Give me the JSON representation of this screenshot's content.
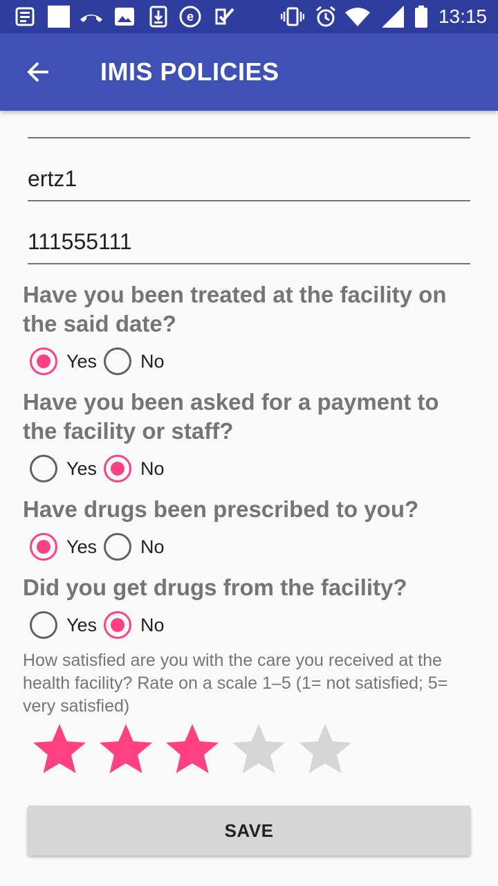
{
  "status_bar": {
    "time": "13:15",
    "icons": [
      "news-icon",
      "square-icon",
      "missed-call-icon",
      "image-icon",
      "download-icon",
      "e-icon",
      "check-icon",
      "vibrate-icon",
      "alarm-icon",
      "wifi-icon",
      "signal-icon",
      "battery-icon"
    ]
  },
  "app_bar": {
    "title": "IMIS POLICIES",
    "back_icon": "arrow-left-icon"
  },
  "fields": [
    {
      "value": ""
    },
    {
      "value": "ertz1"
    },
    {
      "value": "111555111"
    }
  ],
  "questions": [
    {
      "text": "Have you been treated at the facility on the said date?",
      "options": [
        "Yes",
        "No"
      ],
      "selected": "Yes"
    },
    {
      "text": "Have you been asked for a payment to the facility or staff?",
      "options": [
        "Yes",
        "No"
      ],
      "selected": "No"
    },
    {
      "text": "Have drugs been prescribed to you?",
      "options": [
        "Yes",
        "No"
      ],
      "selected": "Yes"
    },
    {
      "text": "Did you get drugs from the facility?",
      "options": [
        "Yes",
        "No"
      ],
      "selected": "No"
    }
  ],
  "rating": {
    "prompt": "How satisfied are you with the care you received at the health facility? Rate on a scale 1–5 (1= not satisfied; 5= very satisfied)",
    "value": 3,
    "max": 5
  },
  "save_label": "SAVE",
  "colors": {
    "primary": "#3f51b5",
    "primary_dark": "#2f3e9e",
    "accent": "#ff4081",
    "star_empty": "#d6d6d6"
  }
}
